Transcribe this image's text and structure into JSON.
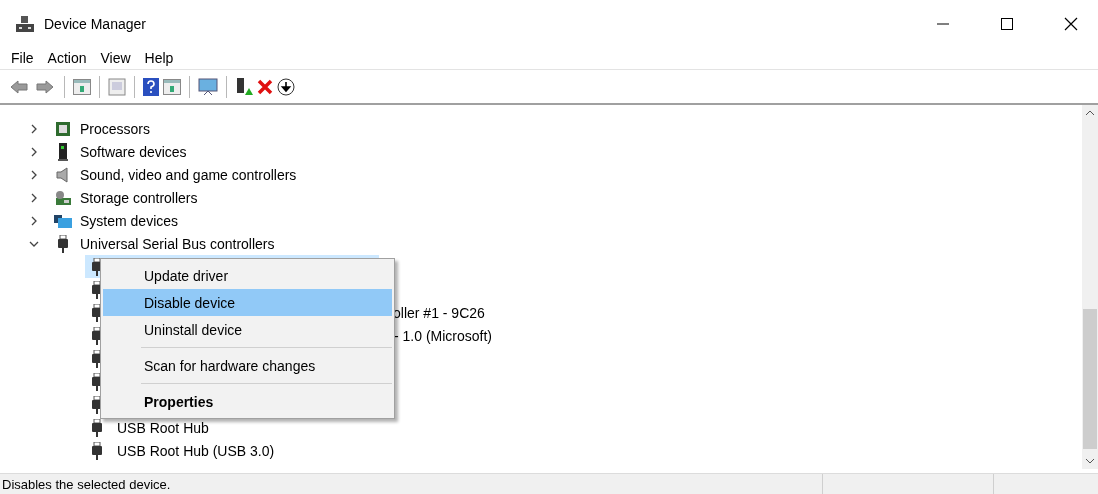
{
  "window": {
    "title": "Device Manager"
  },
  "menu": [
    {
      "label": "File"
    },
    {
      "label": "Action"
    },
    {
      "label": "View"
    },
    {
      "label": "Help"
    }
  ],
  "tree": [
    {
      "label": "Processors",
      "expanded": false
    },
    {
      "label": "Software devices",
      "expanded": false
    },
    {
      "label": "Sound, video and game controllers",
      "expanded": false
    },
    {
      "label": "Storage controllers",
      "expanded": false
    },
    {
      "label": "System devices",
      "expanded": false
    },
    {
      "label": "Universal Serial Bus controllers",
      "expanded": true,
      "children": [
        {
          "kind": "hidden",
          "selected": true
        },
        {
          "kind": "hidden",
          "selected": false
        },
        {
          "kind": "clipped",
          "label": "oller #1 - 9C26",
          "selected": false
        },
        {
          "kind": "clipped",
          "label": "- 1.0 (Microsoft)",
          "selected": false
        },
        {
          "kind": "hidden",
          "selected": false
        },
        {
          "kind": "hidden",
          "selected": false
        },
        {
          "kind": "hidden",
          "selected": false
        },
        {
          "kind": "full",
          "label": "USB Root Hub",
          "selected": false
        },
        {
          "kind": "full",
          "label": "USB Root Hub (USB 3.0)",
          "selected": false
        }
      ]
    }
  ],
  "context_menu": [
    {
      "kind": "item",
      "label": "Update driver",
      "selected": false
    },
    {
      "kind": "item",
      "label": "Disable device",
      "selected": true
    },
    {
      "kind": "item",
      "label": "Uninstall device",
      "selected": false
    },
    {
      "kind": "separator"
    },
    {
      "kind": "item",
      "label": "Scan for hardware changes",
      "selected": false
    },
    {
      "kind": "separator"
    },
    {
      "kind": "default",
      "label": "Properties",
      "selected": false
    }
  ],
  "status_bar": {
    "text": "Disables the selected device."
  }
}
